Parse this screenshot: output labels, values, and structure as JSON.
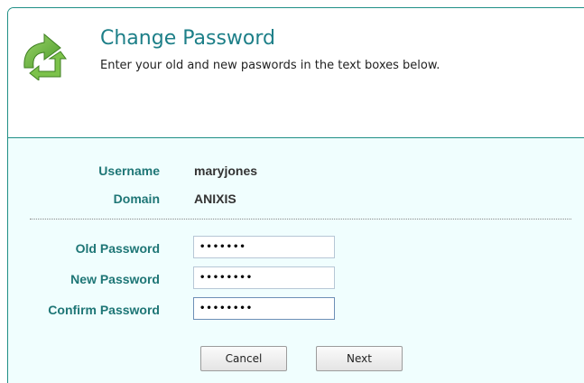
{
  "header": {
    "title": "Change Password",
    "subtitle": "Enter your old and new paswords in the text boxes below.",
    "logo_icon": "green-refresh-arrows-icon"
  },
  "account": {
    "username_label": "Username",
    "username_value": "maryjones",
    "domain_label": "Domain",
    "domain_value": "ANIXIS"
  },
  "form": {
    "old_password_label": "Old Password",
    "old_password_value": "•••••••",
    "new_password_label": "New Password",
    "new_password_value": "••••••••",
    "confirm_password_label": "Confirm Password",
    "confirm_password_value": "••••••••"
  },
  "buttons": {
    "cancel_label": "Cancel",
    "next_label": "Next"
  },
  "colors": {
    "accent": "#1d7f88",
    "content_bg": "#f0fefe",
    "label_color": "#1e7676",
    "logo_green": "#6db33f"
  }
}
